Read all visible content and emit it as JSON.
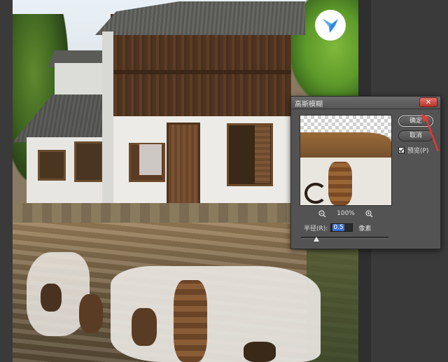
{
  "dialog": {
    "title": "高斯模糊",
    "close_icon": "close-icon",
    "ok_label": "确定",
    "cancel_label": "取消",
    "preview_checkbox": {
      "checked": true,
      "label": "预览(P)"
    },
    "zoom": {
      "zoom_out_icon": "zoom-out-icon",
      "zoom_in_icon": "zoom-in-icon",
      "value": "100%"
    },
    "radius": {
      "label": "半径(R):",
      "value": "0.5",
      "unit": "像素"
    },
    "slider": {
      "value": 0.5
    }
  },
  "overlay": {
    "logo_icon": "bird-logo-icon",
    "arrow_color": "#e53935"
  },
  "colors": {
    "dialog_bg": "#535353",
    "close_button": "#c0392b",
    "selection": "#3b6fcf"
  }
}
